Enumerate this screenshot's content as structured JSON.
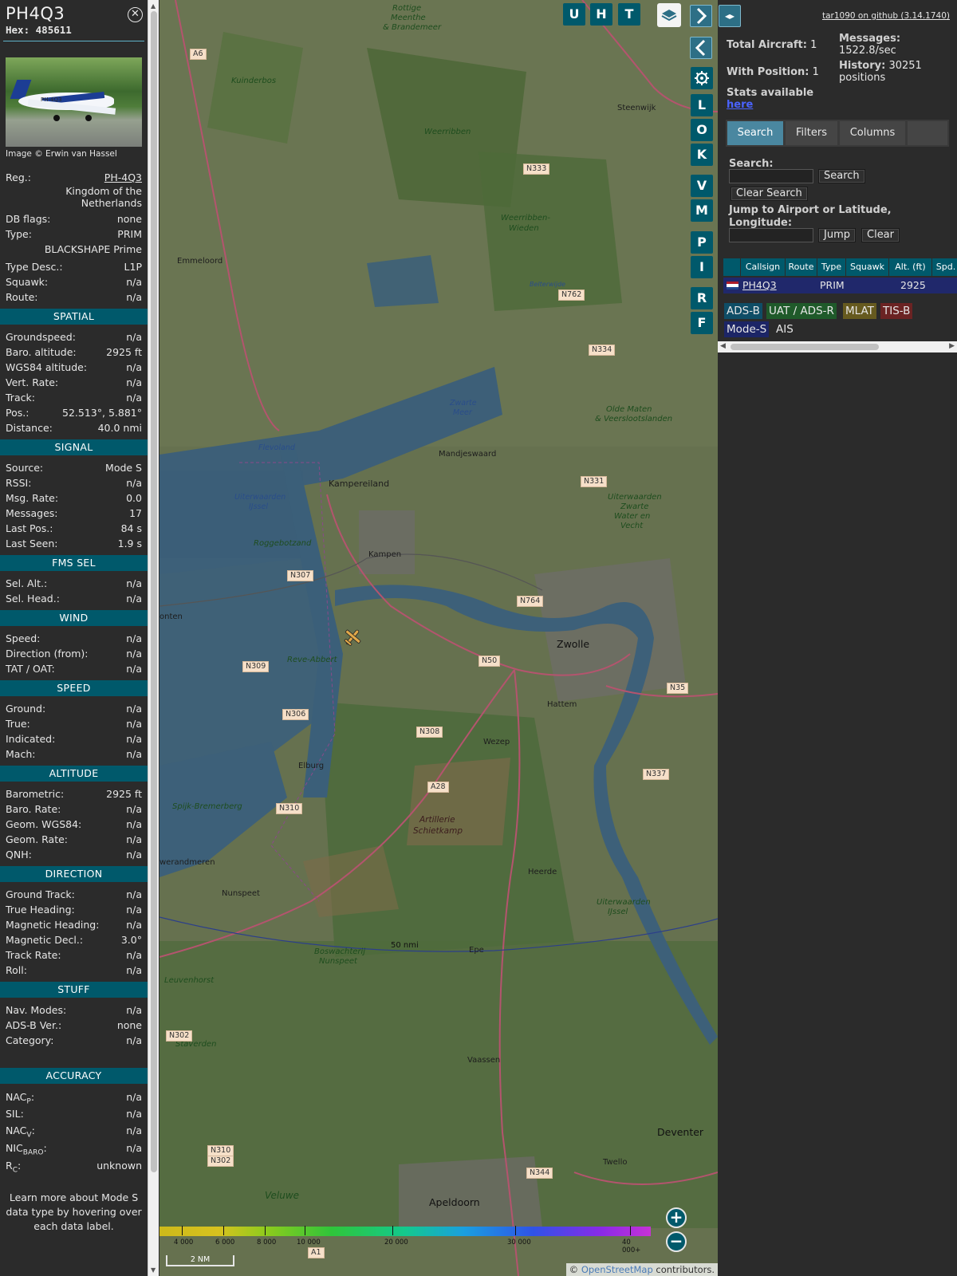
{
  "detail": {
    "callsign": "PH4Q3",
    "hex_label": "Hex:",
    "hex": "485611",
    "photo_reg": "PH-4Q3",
    "photo_credit": "Image © Erwin van Hassel",
    "info": {
      "reg_label": "Reg.:",
      "reg": "PH-4Q3",
      "country_line1": "Kingdom of the",
      "country_line2": "Netherlands",
      "dbflags_label": "DB flags:",
      "dbflags": "none",
      "type_label": "Type:",
      "type": "PRIM",
      "model": "BLACKSHAPE Prime",
      "typedesc_label": "Type Desc.:",
      "typedesc": "L1P",
      "squawk_label": "Squawk:",
      "squawk": "n/a",
      "route_label": "Route:",
      "route": "n/a"
    },
    "spatial": {
      "title": "SPATIAL",
      "rows": [
        {
          "k": "Groundspeed:",
          "v": "n/a"
        },
        {
          "k": "Baro. altitude:",
          "v": "2925 ft"
        },
        {
          "k": "WGS84 altitude:",
          "v": "n/a"
        },
        {
          "k": "Vert. Rate:",
          "v": "n/a"
        },
        {
          "k": "Track:",
          "v": "n/a"
        },
        {
          "k": "Pos.:",
          "v": "52.513°, 5.881°"
        },
        {
          "k": "Distance:",
          "v": "40.0 nmi"
        }
      ]
    },
    "signal": {
      "title": "SIGNAL",
      "rows": [
        {
          "k": "Source:",
          "v": "Mode S"
        },
        {
          "k": "RSSI:",
          "v": "n/a"
        },
        {
          "k": "Msg. Rate:",
          "v": "0.0"
        },
        {
          "k": "Messages:",
          "v": "17"
        },
        {
          "k": "Last Pos.:",
          "v": "84 s"
        },
        {
          "k": "Last Seen:",
          "v": "1.9 s"
        }
      ]
    },
    "fms": {
      "title": "FMS SEL",
      "rows": [
        {
          "k": "Sel. Alt.:",
          "v": "n/a"
        },
        {
          "k": "Sel. Head.:",
          "v": "n/a"
        }
      ]
    },
    "wind": {
      "title": "WIND",
      "rows": [
        {
          "k": "Speed:",
          "v": "n/a"
        },
        {
          "k": "Direction (from):",
          "v": "n/a"
        },
        {
          "k": "TAT / OAT:",
          "v": "n/a"
        }
      ]
    },
    "speed": {
      "title": "SPEED",
      "rows": [
        {
          "k": "Ground:",
          "v": "n/a"
        },
        {
          "k": "True:",
          "v": "n/a"
        },
        {
          "k": "Indicated:",
          "v": "n/a"
        },
        {
          "k": "Mach:",
          "v": "n/a"
        }
      ]
    },
    "altitude": {
      "title": "ALTITUDE",
      "rows": [
        {
          "k": "Barometric:",
          "v": "2925 ft"
        },
        {
          "k": "Baro. Rate:",
          "v": "n/a"
        },
        {
          "k": "Geom. WGS84:",
          "v": "n/a"
        },
        {
          "k": "Geom. Rate:",
          "v": "n/a"
        },
        {
          "k": "QNH:",
          "v": "n/a"
        }
      ]
    },
    "direction": {
      "title": "DIRECTION",
      "rows": [
        {
          "k": "Ground Track:",
          "v": "n/a"
        },
        {
          "k": "True Heading:",
          "v": "n/a"
        },
        {
          "k": "Magnetic Heading:",
          "v": "n/a"
        },
        {
          "k": "Magnetic Decl.:",
          "v": "3.0°"
        },
        {
          "k": "Track Rate:",
          "v": "n/a"
        },
        {
          "k": "Roll:",
          "v": "n/a"
        }
      ]
    },
    "stuff": {
      "title": "STUFF",
      "rows": [
        {
          "k": "Nav. Modes:",
          "v": "n/a"
        },
        {
          "k": "ADS-B Ver.:",
          "v": "none"
        },
        {
          "k": "Category:",
          "v": "n/a"
        }
      ]
    },
    "accuracy": {
      "title": "ACCURACY",
      "nacp_label": "NAC",
      "nacp_sub": "P",
      "nacp": "n/a",
      "sil_label": "SIL:",
      "sil": "n/a",
      "nacv_label": "NAC",
      "nacv_sub": "V",
      "nacv": "n/a",
      "nicbaro_label": "NIC",
      "nicbaro_sub": "BARO",
      "nicbaro": "n/a",
      "rc_label": "R",
      "rc_sub": "C",
      "rc": "unknown"
    },
    "learn_more": "Learn more about Mode S data type by hovering over each data label."
  },
  "map": {
    "buttons": {
      "u": "U",
      "h": "H",
      "t": "T",
      "l": "L",
      "o": "O",
      "k": "K",
      "v": "V",
      "m": "M",
      "p": "P",
      "i": "I",
      "r": "R",
      "f": "F"
    },
    "places": {
      "zwolle": "Zwolle",
      "kampen": "Kampen",
      "kampereiland": "Kampereiland",
      "emmeloord": "Emmeloord",
      "steenwijk": "Steenwijk",
      "hattem": "Hattem",
      "wezep": "Wezep",
      "elburg": "Elburg",
      "nunspeet": "Nunspeet",
      "heerde": "Heerde",
      "epe": "Epe",
      "vaassen": "Vaassen",
      "apeldoorn": "Apeldoorn",
      "deventer": "Deventer",
      "twello": "Twello",
      "mandjeswaard": "Mandjeswaard",
      "artillerie1": "Artillerie",
      "artillerie2": "Schietkamp",
      "weerribben": "Weerribben",
      "weerribben_wieden1": "Weerribben-",
      "weerribben_wieden2": "Wieden",
      "zwarte_meer1": "Zwarte",
      "zwarte_meer2": "Meer",
      "flevoland": "Flevoland",
      "uiterwaarden1": "Uiterwaarden",
      "uiterwaarden2": "IJssel",
      "roggebotzand": "Roggebotzand",
      "reve_abbert": "Reve-Abbert",
      "spijk": "Spijk-Bremerberg",
      "veluwe": "Veluwe",
      "kuinderbos": "Kuinderbos",
      "olde_maten1": "Olde Maten",
      "olde_maten2": "& Veerslootslanden",
      "leuvenhorst": "Leuvenhorst",
      "staverden": "Staverden",
      "boswachterij1": "Boswachterij",
      "boswachterij2": "Nunspeet",
      "werandmeren": "werandmeren",
      "ontcn": "onten",
      "rottige1": "Rottige",
      "rottige2": "Meenthe",
      "rottige3": "& Brandemeer",
      "uiter_zw1": "Uiterwaarden",
      "uiter_zw2": "Zwarte",
      "uiter_zw3": "Water en",
      "uiter_zw4": "Vecht",
      "uiter_ij1": "Uiterwaarden",
      "uiter_ij2": "IJssel",
      "belterwijde": "Belterwijde"
    },
    "roads": [
      "N333",
      "N762",
      "N334",
      "N331",
      "N307",
      "N764",
      "N309",
      "N50",
      "N35",
      "N306",
      "N308",
      "N337",
      "A28",
      "N310",
      "N302",
      "N310",
      "N302",
      "N344",
      "A6",
      "A1"
    ],
    "ring_label": "50 nmi",
    "alt_ticks": [
      "4 000",
      "6 000",
      "8 000",
      "10 000",
      "20 000",
      "30 000",
      "40 000+"
    ],
    "scale": "2 NM",
    "attribution_prefix": "© ",
    "attribution_link": "OpenStreetMap",
    "attribution_suffix": " contributors."
  },
  "right": {
    "github": "tar1090 on github (3.14.1740)",
    "total_aircraft_label": "Total Aircraft:",
    "total_aircraft": "1",
    "with_position_label": "With Position:",
    "with_position": "1",
    "stats_available": "Stats available",
    "here": "here",
    "messages_label": "Messages:",
    "messages": "1522.8/sec",
    "history_label": "History:",
    "history": "30251 positions",
    "tabs": {
      "search": "Search",
      "filters": "Filters",
      "columns": "Columns"
    },
    "search_label": "Search:",
    "search_btn": "Search",
    "clear_search_btn": "Clear Search",
    "jump_label": "Jump to Airport or Latitude, Longitude:",
    "jump_btn": "Jump",
    "clear_btn": "Clear",
    "columns": [
      "Callsign",
      "Route",
      "Type",
      "Squawk",
      "Alt. (ft)",
      "Spd."
    ],
    "row": {
      "callsign": "PH4Q3",
      "route": "",
      "type": "PRIM",
      "squawk": "",
      "alt": "2925",
      "spd": ""
    },
    "sources": {
      "adsb": "ADS-B",
      "uat": "UAT / ADS-R",
      "mlat": "MLAT",
      "tisb": "TIS-B",
      "modes": "Mode-S",
      "ais": "AIS"
    },
    "colors": {
      "adsb": "#0f4d66",
      "uat": "#1f5a2a",
      "mlat": "#665a1f",
      "tisb": "#6b2323",
      "modes": "#1c2566"
    }
  }
}
